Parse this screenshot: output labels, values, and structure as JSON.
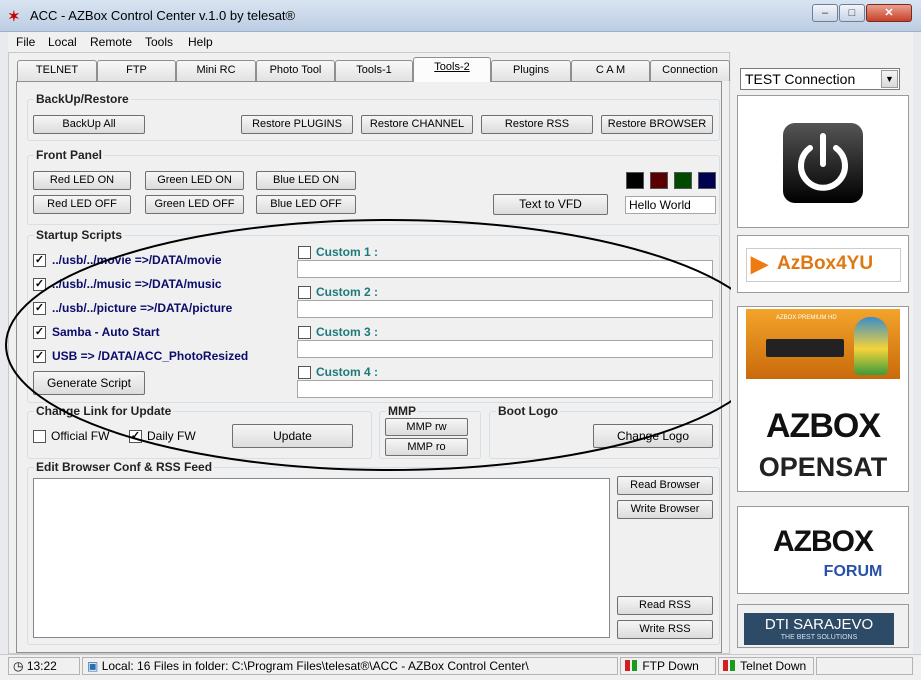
{
  "window": {
    "title": "ACC - AZBox Control Center   v.1.0 by telesat®",
    "icon": "azbox-logo-icon"
  },
  "menu": {
    "items": [
      "File",
      "Local",
      "Remote",
      "Tools",
      "Help"
    ]
  },
  "tabs": [
    {
      "label": "TELNET"
    },
    {
      "label": "FTP"
    },
    {
      "label": "Mini RC"
    },
    {
      "label": "Photo Tool"
    },
    {
      "label": "Tools-1"
    },
    {
      "label": "Tools-2"
    },
    {
      "label": "Plugins"
    },
    {
      "label": "C A M"
    },
    {
      "label": "Connection"
    }
  ],
  "active_tab": "Tools-2",
  "backup": {
    "title": "BackUp/Restore",
    "buttons": [
      "BackUp All",
      "Restore PLUGINS",
      "Restore CHANNEL",
      "Restore RSS",
      "Restore BROWSER"
    ]
  },
  "front_panel": {
    "title": "Front Panel",
    "led_buttons": [
      "Red LED ON",
      "Green LED ON",
      "Blue LED ON",
      "Red LED OFF",
      "Green LED OFF",
      "Blue LED OFF"
    ],
    "text_to_vfd": "Text to VFD",
    "vfd_text": "Hello World",
    "swatch_colors": [
      "#000000",
      "#5a0000",
      "#004a00",
      "#000050"
    ]
  },
  "startup": {
    "title": "Startup Scripts",
    "scripts": [
      {
        "label": "../usb/../movie =>/DATA/movie",
        "checked": true
      },
      {
        "label": "../usb/../music =>/DATA/music",
        "checked": true
      },
      {
        "label": "../usb/../picture =>/DATA/picture",
        "checked": true
      },
      {
        "label": "Samba - Auto Start",
        "checked": true
      },
      {
        "label": "USB => /DATA/ACC_PhotoResized",
        "checked": true
      }
    ],
    "generate_button": "Generate Script",
    "customs": [
      {
        "label": "Custom 1 :",
        "value": ""
      },
      {
        "label": "Custom 2 :",
        "value": ""
      },
      {
        "label": "Custom 3 :",
        "value": ""
      },
      {
        "label": "Custom 4 :",
        "value": ""
      }
    ]
  },
  "update": {
    "title": "Change Link for Update",
    "official_label": "Official FW",
    "official_checked": false,
    "daily_label": "Daily FW",
    "daily_checked": true,
    "button": "Update"
  },
  "mmp": {
    "title": "MMP",
    "rw": "MMP rw",
    "ro": "MMP ro"
  },
  "boot_logo": {
    "title": "Boot Logo",
    "button": "Change Logo"
  },
  "browser": {
    "title": "Edit Browser Conf & RSS Feed",
    "read_browser": "Read Browser",
    "write_browser": "Write Browser",
    "read_rss": "Read RSS",
    "write_rss": "Write RSS",
    "content": ""
  },
  "sidebar": {
    "connection_select": "TEST Connection",
    "ad1": "AzBox4YU",
    "ad2_line1": "AZBOX",
    "ad2_line2": "OPENSAT",
    "ad2_small": "AZBOX PREMIUM HD",
    "ad3_line1": "AZBOX",
    "ad3_line2": "FORUM",
    "ad4_line1": "DTI SARAJEVO",
    "ad4_line2": "THE BEST SOLUTIONS"
  },
  "status": {
    "time": "13:22",
    "path": "Local: 16 Files in folder: C:\\Program Files\\telesat®\\ACC - AZBox Control Center\\",
    "ftp": "FTP Down",
    "telnet": "Telnet Down"
  }
}
